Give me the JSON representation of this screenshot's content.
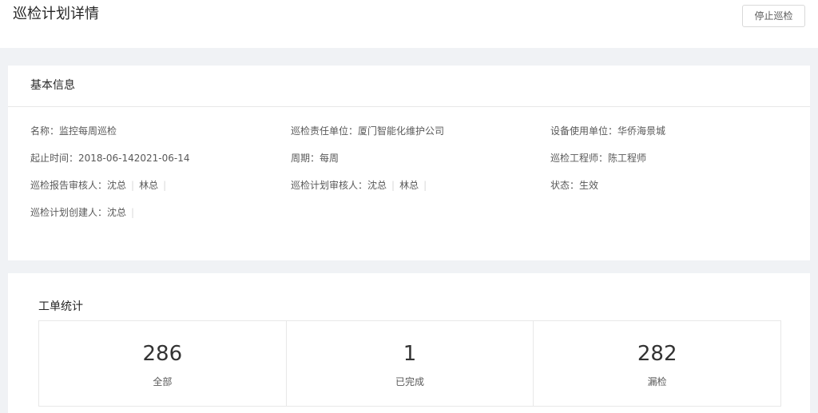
{
  "header": {
    "title": "巡检计划详情",
    "stop_button": "停止巡检"
  },
  "basic": {
    "title": "基本信息",
    "name_label": "名称：",
    "name_value": "监控每周巡检",
    "resp_unit_label": "巡检责任单位：",
    "resp_unit_value": "厦门智能化维护公司",
    "use_unit_label": "设备使用单位：",
    "use_unit_value": "华侨海景城",
    "period_time_label": "起止时间：",
    "period_time_value": "2018-06-142021-06-14",
    "cycle_label": "周期：",
    "cycle_value": "每周",
    "engineer_label": "巡检工程师：",
    "engineer_value": "陈工程师",
    "report_reviewer_label": "巡检报告审核人：",
    "report_reviewers": [
      "沈总",
      "林总"
    ],
    "plan_reviewer_label": "巡检计划审核人：",
    "plan_reviewers": [
      "沈总",
      "林总"
    ],
    "status_label": "状态：",
    "status_value": "生效",
    "creator_label": "巡检计划创建人：",
    "creators": [
      "沈总"
    ]
  },
  "stats": {
    "title": "工单统计",
    "items": [
      {
        "number": "286",
        "label": "全部"
      },
      {
        "number": "1",
        "label": "已完成"
      },
      {
        "number": "282",
        "label": "漏检"
      }
    ]
  }
}
